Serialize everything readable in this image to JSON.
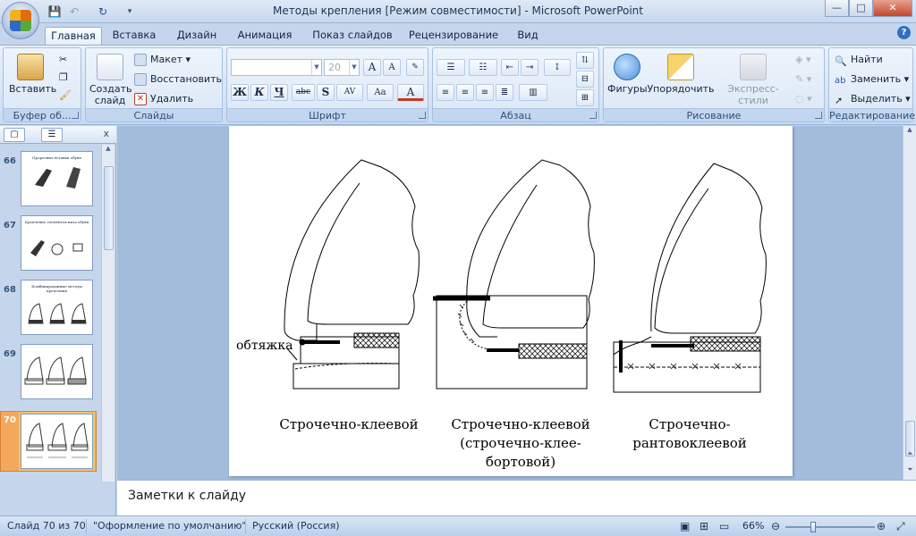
{
  "window": {
    "title": "Методы крепления [Режим совместимости] - Microsoft PowerPoint",
    "controls": [
      "—",
      "□",
      "✕"
    ]
  },
  "qat": {
    "save": "💾",
    "undo": "↶",
    "redo": "↻",
    "more": "▾"
  },
  "tabs": [
    "Главная",
    "Вставка",
    "Дизайн",
    "Анимация",
    "Показ слайдов",
    "Рецензирование",
    "Вид"
  ],
  "help": "?",
  "ribbon": {
    "clipboard": {
      "label": "Буфер об...",
      "paste": "Вставить"
    },
    "slides": {
      "label": "Слайды",
      "new_slide": "Создать слайд",
      "layout": "Макет",
      "reset": "Восстановить",
      "delete": "Удалить"
    },
    "font": {
      "label": "Шрифт",
      "font_name": "",
      "font_size": "20",
      "buttons": [
        "Ж",
        "К",
        "Ч",
        "abc",
        "S",
        "AV",
        "Aa",
        "A"
      ]
    },
    "paragraph": {
      "label": "Абзац"
    },
    "drawing": {
      "label": "Рисование",
      "shapes": "Фигуры",
      "arrange": "Упорядочить",
      "quick_styles": "Экспресс-стили"
    },
    "editing": {
      "label": "Редактирование",
      "find": "Найти",
      "replace": "Заменить",
      "select": "Выделить"
    }
  },
  "slides_panel": {
    "close": "x",
    "thumbnails": [
      {
        "num": "66",
        "title": "Прорезные вставки обуви"
      },
      {
        "num": "67",
        "title": "Крепление элементов низа обуви"
      },
      {
        "num": "68",
        "title": "Комбинированные методы крепления"
      },
      {
        "num": "69",
        "title": ""
      },
      {
        "num": "70",
        "title": ""
      }
    ],
    "selected": "70"
  },
  "slide": {
    "label_obtyazhka": "обтяжка",
    "captions": [
      [
        "Строчечно-клеевой"
      ],
      [
        "Строчечно-клеевой",
        "(строчечно-клее-",
        "бортовой)"
      ],
      [
        "Строчечно-",
        "рантовоклеевой"
      ]
    ]
  },
  "notes": {
    "placeholder": "Заметки к слайду"
  },
  "status": {
    "slide": "Слайд 70 из 70",
    "theme": "\"Оформление по умолчанию\"",
    "language": "Русский (Россия)",
    "zoom": "66%",
    "zoom_level": 0.66
  }
}
